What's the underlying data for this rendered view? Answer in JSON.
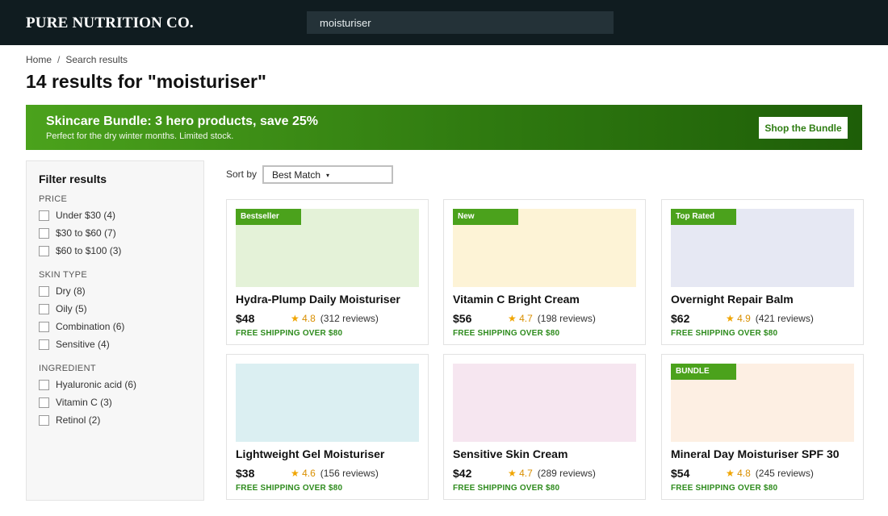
{
  "brand": {
    "name": "PURE NUTRITION CO."
  },
  "search": {
    "value": "moisturiser"
  },
  "breadcrumb": {
    "items": [
      "Home",
      "Search results"
    ],
    "separator": "/"
  },
  "results": {
    "title": "14 results for \"moisturiser\""
  },
  "promo": {
    "title": "Skincare Bundle: 3 hero products, save 25%",
    "subtitle": "Perfect for the dry winter months. Limited stock.",
    "button_label": "Shop the Bundle"
  },
  "filters": {
    "title": "Filter results",
    "groups": [
      {
        "title": "PRICE",
        "options": [
          {
            "label": "Under $30 (4)",
            "checked": false
          },
          {
            "label": "$30 to $60 (7)",
            "checked": false
          },
          {
            "label": "$60 to $100 (3)",
            "checked": false
          }
        ]
      },
      {
        "title": "SKIN TYPE",
        "options": [
          {
            "label": "Dry (8)",
            "checked": false
          },
          {
            "label": "Oily (5)",
            "checked": false
          },
          {
            "label": "Combination (6)",
            "checked": false
          },
          {
            "label": "Sensitive (4)",
            "checked": false
          }
        ]
      },
      {
        "title": "INGREDIENT",
        "options": [
          {
            "label": "Hyaluronic acid (6)",
            "checked": false
          },
          {
            "label": "Vitamin C (3)",
            "checked": false
          },
          {
            "label": "Retinol (2)",
            "checked": false
          }
        ]
      }
    ]
  },
  "sort": {
    "label": "Sort by",
    "selected": "Best Match",
    "caret": "▾"
  },
  "products": [
    {
      "badge": "Bestseller",
      "name": "Hydra-Plump Daily Moisturiser",
      "price": "$48",
      "star": "★",
      "rating": "4.8",
      "reviews": "(312 reviews)",
      "shipping": "FREE SHIPPING OVER $80",
      "thumb_color": "#e4f2d8"
    },
    {
      "badge": "New",
      "name": "Vitamin C Bright Cream",
      "price": "$56",
      "star": "★",
      "rating": "4.7",
      "reviews": "(198 reviews)",
      "shipping": "FREE SHIPPING OVER $80",
      "thumb_color": "#fdf3d6"
    },
    {
      "badge": "Top Rated",
      "name": "Overnight Repair Balm",
      "price": "$62",
      "star": "★",
      "rating": "4.9",
      "reviews": "(421 reviews)",
      "shipping": "FREE SHIPPING OVER $80",
      "thumb_color": "#e6e8f3"
    },
    {
      "badge": "",
      "name": "Lightweight Gel Moisturiser",
      "price": "$38",
      "star": "★",
      "rating": "4.6",
      "reviews": "(156 reviews)",
      "shipping": "FREE SHIPPING OVER $80",
      "thumb_color": "#dbeff2"
    },
    {
      "badge": "",
      "name": "Sensitive Skin Cream",
      "price": "$42",
      "star": "★",
      "rating": "4.7",
      "reviews": "(289 reviews)",
      "shipping": "FREE SHIPPING OVER $80",
      "thumb_color": "#f6e6f0"
    },
    {
      "badge": "BUNDLE",
      "name": "Mineral Day Moisturiser SPF 30",
      "price": "$54",
      "star": "★",
      "rating": "4.8",
      "reviews": "(245 reviews)",
      "shipping": "FREE SHIPPING OVER $80",
      "thumb_color": "#fdefe3"
    }
  ],
  "colors": {
    "header_bg": "#101c20",
    "accent_green": "#4ba21c",
    "star": "#f0a500",
    "shipping_text": "#2e8b1d"
  }
}
